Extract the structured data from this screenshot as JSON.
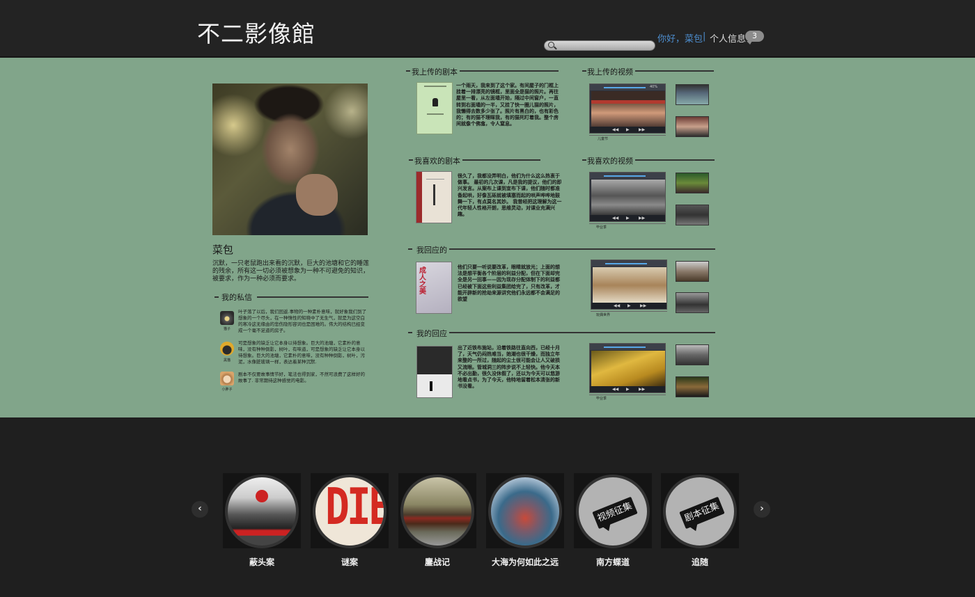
{
  "header": {
    "logo": "不二影像館",
    "search_placeholder": "",
    "greeting": "你好，菜包",
    "separator": "|",
    "profile_link": "个人信息",
    "message_count": "3"
  },
  "profile": {
    "name": "菜包",
    "bio": "沉默，一只老鼠跑出来看的沉默，巨大的池塘和它的睡莲的残余，所有这一切必须被想象为一种不可避免的知识，被要求，作为一种必须而要求。",
    "messages_title": "我的私信",
    "messages": [
      {
        "name": "猫子",
        "text": "叶子落了以后，我们回返.事物的一种素朴意味，就好象我们到了想象的一个尽头，在一种惰性的知晓中了无生气，就是为这空白的寒冷这无缘由的悲伤隐形容词也是困难的。伟大的结构已经变成一个毫不足道的房子。"
      },
      {
        "name": "黑猫",
        "text": "可是想象的缺乏让它本身以待想象。巨大的池塘，它素朴的意味，没有种种倒影，树叶，有味道，可是想象的缺乏让它本身以待想象。巨大的池塘，它素朴的意味，没有种种倒影，树叶，污泥，水像脏玻璃一样，表达着某种沉默."
      },
      {
        "name": "小胖子",
        "text": "剧本不仅要故事情节好，笔法也得到家，不然可浪费了这样好的故事了. 非常期待这种感觉的电影。"
      }
    ]
  },
  "uploaded_scripts": {
    "title": "我上传的剧本",
    "text": "一个雨天，我来到了这个家。有间屋子的门框上挂着一排漂亮的镜框，里面全是猫的照片。再往屋里一看，从左面墙开始，隔过中间窗户，一直转到右面墙的一半，又挂了快一圈儿猫的照片，我懒得去数多少张了。照片有黑白的，也有彩色的；有的猫不理睬我，有的猫死盯着我。整个房间就像个佛龛，令人窒息。"
  },
  "uploaded_videos": {
    "title": "我上传的视频",
    "caption": "儿童节",
    "volume": "40%"
  },
  "liked_scripts": {
    "title": "我喜欢的剧本",
    "text": "很久了，我都没弄明白，他们为什么这么热衷于做事。 最初的几次课，凡是我的提议，他们的即兴发言。从案布上课到宣布下课，他们随时都准备起哄，好像瓦砾就被填塞而起的哄声哗哗地鼓舞一下，有点莫名其妙。 我曾经把这理解为这一代年轻人性格开朗，思维灵动，对课业充满兴趣。"
  },
  "liked_videos": {
    "title": "我喜欢的视频",
    "caption": "毕业季"
  },
  "my_replied": {
    "title": "我回应的",
    "text": "他们只要一听说要改革，眼睛就放光；上面的想法是想平衡各个阶层的利益分配，但在下面却完全是另一回事——因为现存分配体制下的利益都已经被下面这些利益集团给完了，只有改革，才能开辟新的抢劫来源讲究他们永远都不会满足的欲望",
    "caption": "玩偶世界"
  },
  "my_replies": {
    "title": "我的回应",
    "text": "出了近铁布施站，沿着铁路往直向西，已经十月了，天气仍闷热难当，她潮也很干燥，而独立年来整的一所过，随起的尘土很可能会让人又破损又流眼。管城洞三的阵步说不上轻快。他今天本不必出勤，很久没休假了，还以为今天可以悠游地看点书，为了今天，他特地留着松本清张的新书没看。",
    "caption": "毕业季"
  },
  "footer": {
    "films": [
      {
        "title": "蔽头案"
      },
      {
        "title": "谜案"
      },
      {
        "title": "鏖战记"
      },
      {
        "title": "大海为何如此之远"
      },
      {
        "title": "南方蝶道",
        "tag": "视频征集"
      },
      {
        "title": "追随",
        "tag": "剧本征集"
      }
    ],
    "poster_text": "DIE"
  }
}
